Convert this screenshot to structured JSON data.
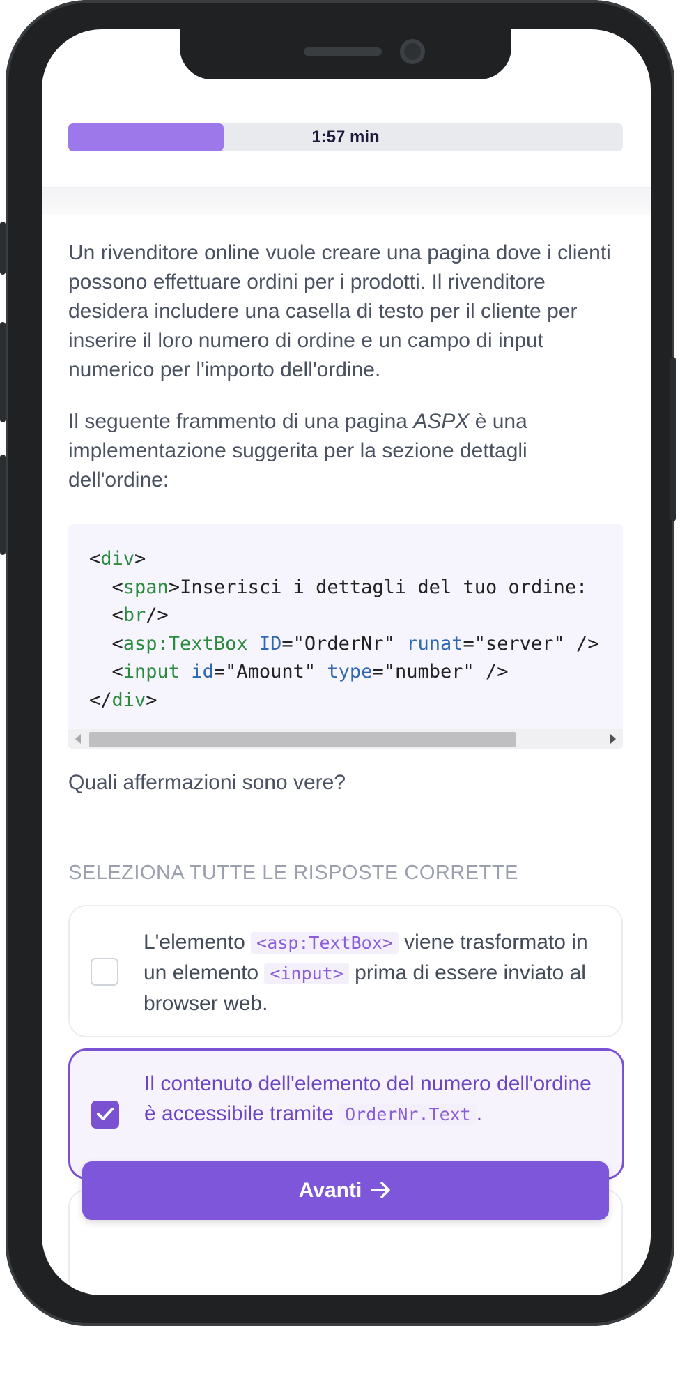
{
  "timer": {
    "label": "1:57 min",
    "progress": 0.28
  },
  "question": {
    "paragraph1": "Un rivenditore online vuole creare una pagina dove i clienti possono effettuare ordini per i prodotti. Il rivenditore desidera includere una casella di testo per il cliente per inserire il loro numero di ordine e un campo di input numerico per l'importo dell'ordine.",
    "paragraph2_before": "Il seguente frammento di una pagina ",
    "paragraph2_em": "ASPX",
    "paragraph2_after": " è una implementazione suggerita per la sezione dettagli dell'ordine:",
    "prompt": "Quali affermazioni sono vere?"
  },
  "code": {
    "line1_open": "<",
    "line1_tag": "div",
    "line1_close": ">",
    "line2_open": "  <",
    "line2_tag": "span",
    "line2_text": ">Inserisci i dettagli del tuo ordine:",
    "line3_open": "  <",
    "line3_tag": "br",
    "line3_close": "/>",
    "line4_open": "  <",
    "line4_tag": "asp:TextBox",
    "line4_attr1": "ID",
    "line4_val1": "=\"OrderNr\" ",
    "line4_attr2": "runat",
    "line4_val2": "=\"server\" />",
    "line5_open": "  <",
    "line5_tag": "input",
    "line5_attr1": "id",
    "line5_val1": "=\"Amount\" ",
    "line5_attr2": "type",
    "line5_val2": "=\"number\" />",
    "line6_open": "</",
    "line6_tag": "div",
    "line6_close": ">"
  },
  "instruction": "SELEZIONA TUTTE LE RISPOSTE CORRETTE",
  "options": [
    {
      "t1": "L'elemento ",
      "c1": "<asp:TextBox>",
      "t2": " viene trasformato in un elemento ",
      "c2": "<input>",
      "t3": " prima di essere inviato al browser web.",
      "checked": false
    },
    {
      "t1": "Il contenuto dell'elemento del numero dell'ordine è accessibile tramite ",
      "c1": "OrderNr.Text",
      "t2": ".",
      "checked": true
    }
  ],
  "next_button": {
    "label": "Avanti",
    "icon": "arrow-right-icon"
  },
  "colors": {
    "accent": "#7e56d9",
    "code_tag": "#2a8a3e",
    "code_attr": "#2f68b0"
  }
}
